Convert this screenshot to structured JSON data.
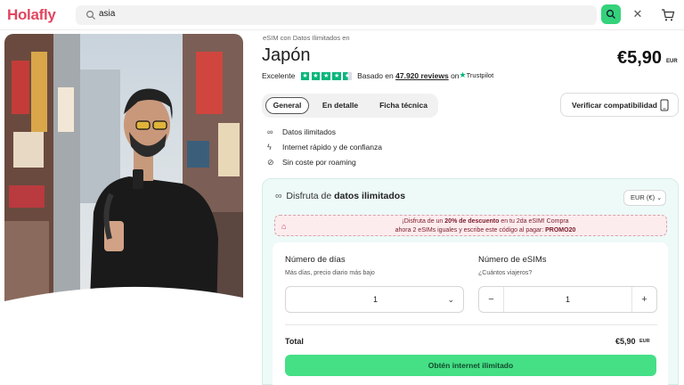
{
  "header": {
    "logo": "Holafly",
    "search_value": "asia",
    "icons": {
      "search": "search-icon",
      "close": "close-icon",
      "cart": "cart-icon"
    },
    "accent": "#34d27b",
    "brand": "#e2455f"
  },
  "product": {
    "breadcrumb": "eSIM con Datos Ilimitados en",
    "title": "Japón",
    "price": "€5,90",
    "price_currency": "EUR",
    "rating_label": "Excelente",
    "rating_stars": 4.5,
    "reviews_prefix": "Basado en",
    "reviews_count": "47.920 reviews",
    "reviews_on": "on",
    "trustpilot": "Trustpilot"
  },
  "tabs": [
    {
      "label": "General",
      "active": true
    },
    {
      "label": "En detalle",
      "active": false
    },
    {
      "label": "Ficha técnica",
      "active": false
    }
  ],
  "compat_button": "Verificar compatibilidad",
  "features": [
    {
      "icon": "infinity-icon",
      "text": "Datos ilimitados"
    },
    {
      "icon": "lightning-icon",
      "text": "Internet rápido y de confianza"
    },
    {
      "icon": "no-roaming-icon",
      "text": "Sin coste por roaming"
    }
  ],
  "purchase": {
    "heading_prefix": "Disfruta de",
    "heading_bold": "datos ilimitados",
    "currency_select": "EUR (€)",
    "promo": {
      "line1_a": "¡Disfruta de un",
      "line1_b": "20% de descuento",
      "line1_c": "en tu 2da eSIM! Compra",
      "line2_a": "ahora 2 eSIMs iguales y escribe este código al pagar:",
      "line2_b": "PROMO20"
    },
    "days_label": "Número de días",
    "days_sub": "Más días, precio diario más bajo",
    "days_value": "1",
    "esims_label": "Número de eSIMs",
    "esims_sub": "¿Cuántos viajeros?",
    "esims_value": "1",
    "total_label": "Total",
    "total_value": "€5,90",
    "total_currency": "EUR",
    "cta": "Obtén internet ilimitado",
    "cta_color": "#45df86"
  }
}
